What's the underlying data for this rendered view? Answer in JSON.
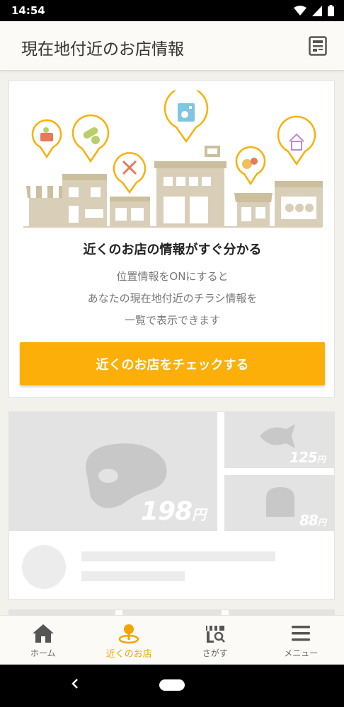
{
  "status_bar": {
    "time": "14:54"
  },
  "app_bar": {
    "title": "現在地付近のお店情報",
    "action_icon": "newspaper-icon"
  },
  "hero": {
    "heading": "近くのお店の情報がすぐ分かる",
    "description": [
      "位置情報をONにすると",
      "あなたの現在地付近のチラシ情報を",
      "一覧で表示できます"
    ],
    "cta_label": "近くのお店をチェックする",
    "accent_color": "#fbaf08"
  },
  "placeholder": {
    "prices": {
      "big": "198",
      "small1": "125",
      "small2": "88",
      "unit": "円"
    }
  },
  "bottom_nav": {
    "items": [
      {
        "label": "ホーム",
        "icon": "home-icon",
        "active": false
      },
      {
        "label": "近くのお店",
        "icon": "location-pin-icon",
        "active": true
      },
      {
        "label": "さがす",
        "icon": "store-search-icon",
        "active": false
      },
      {
        "label": "メニュー",
        "icon": "hamburger-menu-icon",
        "active": false
      }
    ]
  }
}
